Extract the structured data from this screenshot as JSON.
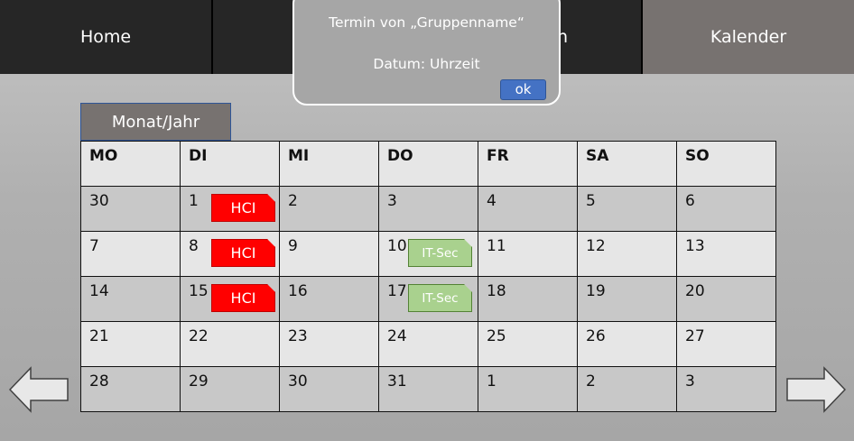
{
  "nav": {
    "tabs": [
      {
        "label": "Home"
      },
      {
        "label": ""
      },
      {
        "label": "n"
      },
      {
        "label": "Kalender"
      }
    ]
  },
  "popup": {
    "title": "Termin von „Gruppenname“",
    "date": "Datum: Uhrzeit",
    "ok_label": "ok"
  },
  "calendar": {
    "month_label": "Monat/Jahr",
    "weekdays": [
      "MO",
      "DI",
      "MI",
      "DO",
      "FR",
      "SA",
      "SO"
    ],
    "weeks": [
      [
        "30",
        "1",
        "2",
        "3",
        "4",
        "5",
        "6"
      ],
      [
        "7",
        "8",
        "9",
        "10",
        "11",
        "12",
        "13"
      ],
      [
        "14",
        "15",
        "16",
        "17",
        "18",
        "19",
        "20"
      ],
      [
        "21",
        "22",
        "23",
        "24",
        "25",
        "26",
        "27"
      ],
      [
        "28",
        "29",
        "30",
        "31",
        "1",
        "2",
        "3"
      ]
    ],
    "events": {
      "hci": "HCI",
      "itsec": "IT-Sec"
    }
  },
  "colors": {
    "hci": "#ff0000",
    "itsec": "#a9d18e",
    "active_tab": "#777270",
    "ok_button": "#4472c4"
  },
  "icons": {
    "prev": "arrow-left-icon",
    "next": "arrow-right-icon"
  }
}
